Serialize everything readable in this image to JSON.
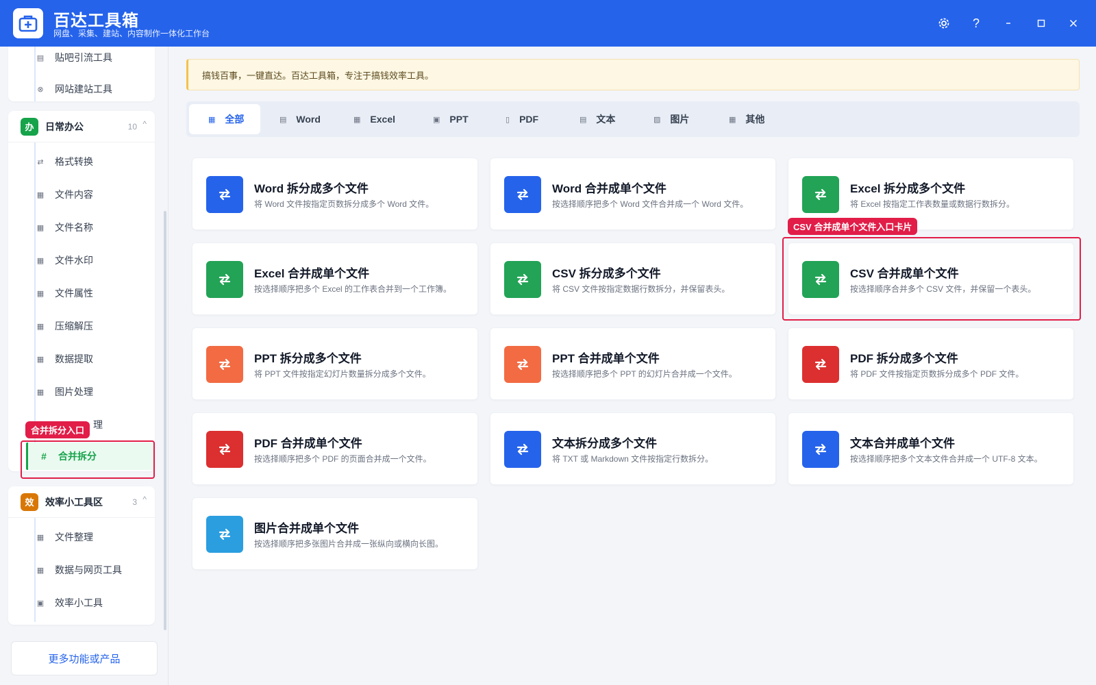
{
  "app": {
    "name": "百达工具箱",
    "subtitle": "网盘、采集、建站、内容制作一体化工作台"
  },
  "window_controls": [
    "settings",
    "help",
    "minimize",
    "maximize",
    "close"
  ],
  "sidebar": {
    "top_items": [
      {
        "label": "贴吧引流工具",
        "icon": "doc-icon"
      },
      {
        "label": "网站建站工具",
        "icon": "globe-icon"
      }
    ],
    "groups": [
      {
        "badge": "办",
        "badge_color": "#16a34a",
        "title": "日常办公",
        "count": "10",
        "caret": "^",
        "items": [
          {
            "label": "格式转换",
            "icon": "⇄"
          },
          {
            "label": "文件内容",
            "icon": "▦"
          },
          {
            "label": "文件名称",
            "icon": "▦"
          },
          {
            "label": "文件水印",
            "icon": "▦"
          },
          {
            "label": "文件属性",
            "icon": "▦"
          },
          {
            "label": "压缩解压",
            "icon": "▦"
          },
          {
            "label": "数据提取",
            "icon": "▦"
          },
          {
            "label": "图片处理",
            "icon": "▦"
          },
          {
            "label": "理",
            "icon": "▦"
          },
          {
            "label": "合并拆分",
            "icon": "#"
          }
        ]
      },
      {
        "badge": "效",
        "badge_color": "#d97706",
        "title": "效率小工具区",
        "count": "3",
        "caret": "^",
        "items": [
          {
            "label": "文件整理",
            "icon": "▦"
          },
          {
            "label": "数据与网页工具",
            "icon": "▦"
          },
          {
            "label": "效率小工具",
            "icon": "▣"
          }
        ]
      }
    ],
    "more_button": "更多功能或产品"
  },
  "annotations": {
    "sidebar_tag": "合并拆分入口",
    "card_tag": "CSV 合并成单个文件入口卡片"
  },
  "notice": "搞钱百事，一键直达。百达工具箱，专注于搞钱效率工具。",
  "tabs": [
    {
      "label": "全部",
      "active": true
    },
    {
      "label": "Word"
    },
    {
      "label": "Excel"
    },
    {
      "label": "PPT"
    },
    {
      "label": "PDF"
    },
    {
      "label": "文本"
    },
    {
      "label": "图片"
    },
    {
      "label": "其他"
    }
  ],
  "cards": [
    {
      "title": "Word 拆分成多个文件",
      "desc": "将 Word 文件按指定页数拆分成多个 Word 文件。",
      "color": "#2563eb"
    },
    {
      "title": "Word 合并成单个文件",
      "desc": "按选择顺序把多个 Word 文件合并成一个 Word 文件。",
      "color": "#2563eb"
    },
    {
      "title": "Excel 拆分成多个文件",
      "desc": "将 Excel 按指定工作表数量或数据行数拆分。",
      "color": "#22a356"
    },
    {
      "title": "Excel 合并成单个文件",
      "desc": "按选择顺序把多个 Excel 的工作表合并到一个工作簿。",
      "color": "#22a356"
    },
    {
      "title": "CSV 拆分成多个文件",
      "desc": "将 CSV 文件按指定数据行数拆分，并保留表头。",
      "color": "#22a356"
    },
    {
      "title": "CSV 合并成单个文件",
      "desc": "按选择顺序合并多个 CSV 文件，并保留一个表头。",
      "color": "#22a356"
    },
    {
      "title": "PPT 拆分成多个文件",
      "desc": "将 PPT 文件按指定幻灯片数量拆分成多个文件。",
      "color": "#f26b43"
    },
    {
      "title": "PPT 合并成单个文件",
      "desc": "按选择顺序把多个 PPT 的幻灯片合并成一个文件。",
      "color": "#f26b43"
    },
    {
      "title": "PDF 拆分成多个文件",
      "desc": "将 PDF 文件按指定页数拆分成多个 PDF 文件。",
      "color": "#dc2f2f"
    },
    {
      "title": "PDF 合并成单个文件",
      "desc": "按选择顺序把多个 PDF 的页面合并成一个文件。",
      "color": "#dc2f2f"
    },
    {
      "title": "文本拆分成多个文件",
      "desc": "将 TXT 或 Markdown 文件按指定行数拆分。",
      "color": "#2563eb"
    },
    {
      "title": "文本合并成单个文件",
      "desc": "按选择顺序把多个文本文件合并成一个 UTF-8 文本。",
      "color": "#2563eb"
    },
    {
      "title": "图片合并成单个文件",
      "desc": "按选择顺序把多张图片合并成一张纵向或横向长图。",
      "color": "#2b9ee0"
    }
  ]
}
